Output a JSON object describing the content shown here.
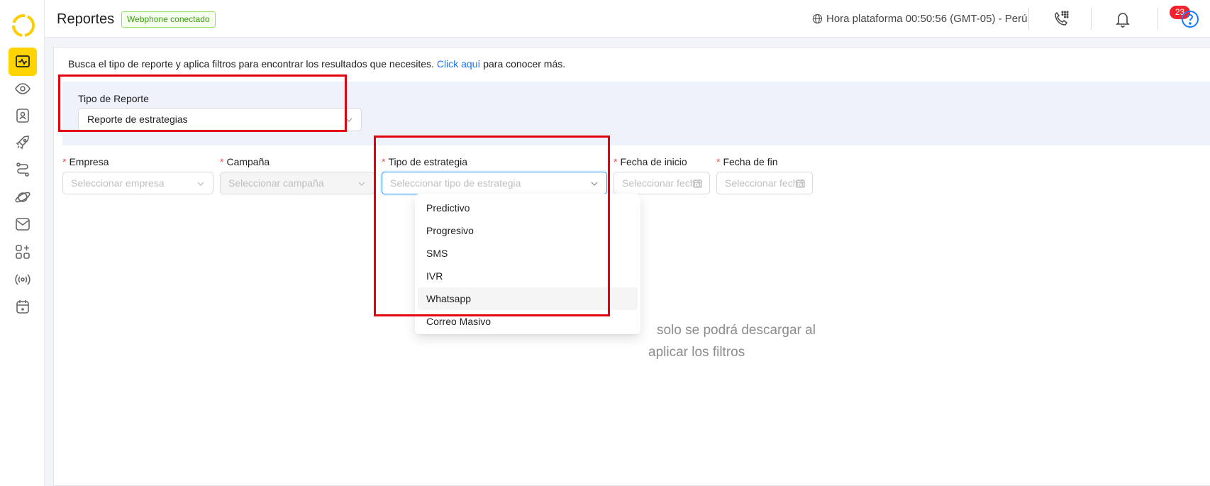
{
  "colors": {
    "accent": "#ffd400",
    "link": "#1677ff",
    "highlight_box": "#e3000f",
    "badge_green": "#389e0d",
    "notification": "#f5222d"
  },
  "sidebar": {
    "items": [
      {
        "icon": "chart-monitor-icon",
        "active": true
      },
      {
        "icon": "eye-icon"
      },
      {
        "icon": "contact-card-icon"
      },
      {
        "icon": "rocket-icon"
      },
      {
        "icon": "route-icon"
      },
      {
        "icon": "planet-icon"
      },
      {
        "icon": "mail-icon"
      },
      {
        "icon": "apps-plus-icon"
      },
      {
        "icon": "broadcast-icon"
      },
      {
        "icon": "calendar-icon"
      }
    ]
  },
  "header": {
    "title": "Reportes",
    "webphone_status": "Webphone conectado",
    "clock": "Hora plataforma 00:50:56 (GMT-05) - Perú",
    "notifications_count": "23"
  },
  "main": {
    "intro_before": "Busca el tipo de reporte y aplica filtros para encontrar los resultados que necesites.",
    "intro_link": "Click aquí",
    "intro_after": "para conocer más.",
    "report_type": {
      "label": "Tipo de Reporte",
      "value": "Reporte de estrategias"
    },
    "filters": {
      "empresa": {
        "label": "Empresa",
        "placeholder": "Seleccionar empresa"
      },
      "campana": {
        "label": "Campaña",
        "placeholder": "Seleccionar campaña"
      },
      "estrategia": {
        "label": "Tipo de estrategia",
        "placeholder": "Seleccionar tipo de estrategia"
      },
      "fecha_inicio": {
        "label": "Fecha de inicio",
        "placeholder": "Seleccionar fecha"
      },
      "fecha_fin": {
        "label": "Fecha de fin",
        "placeholder": "Seleccionar fecha"
      }
    },
    "strategy_options": [
      "Predictivo",
      "Progresivo",
      "SMS",
      "IVR",
      "Whatsapp",
      "Correo Masivo"
    ],
    "hovered_option": "Whatsapp",
    "empty_message_line1": "solo se podrá descargar al",
    "empty_message_line2": "aplicar los filtros"
  }
}
